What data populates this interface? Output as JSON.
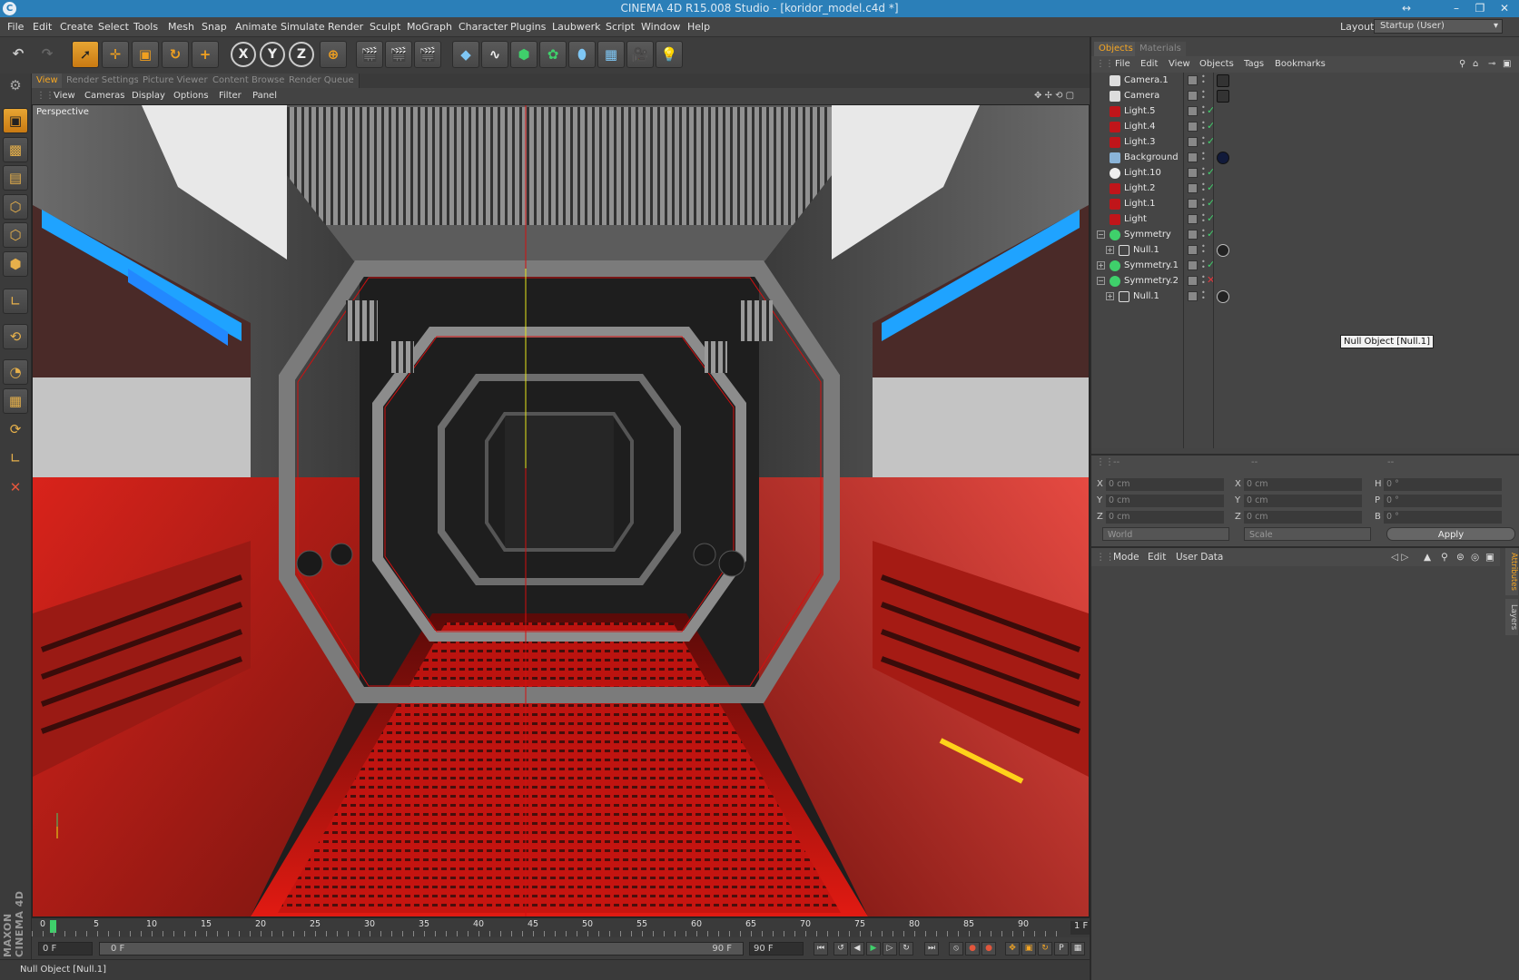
{
  "window": {
    "title": "CINEMA 4D R15.008 Studio - [koridor_model.c4d *]"
  },
  "menu": [
    "File",
    "Edit",
    "Create",
    "Select",
    "Tools",
    "Mesh",
    "Snap",
    "Animate",
    "Simulate",
    "Render",
    "Sculpt",
    "MoGraph",
    "Character",
    "Plugins",
    "Laubwerk",
    "Script",
    "Window",
    "Help"
  ],
  "layout": {
    "label": "Layout:",
    "value": "Startup (User)"
  },
  "axis_buttons": [
    "X",
    "Y",
    "Z"
  ],
  "view_tabs": [
    "View",
    "Render Settings",
    "Picture Viewer",
    "Content Browser",
    "Render Queue"
  ],
  "view_menu": [
    "View",
    "Cameras",
    "Display",
    "Options",
    "Filter",
    "Panel"
  ],
  "viewport": {
    "label": "Perspective"
  },
  "timeline": {
    "ticks": [
      "0",
      "5",
      "10",
      "15",
      "20",
      "25",
      "30",
      "35",
      "40",
      "45",
      "50",
      "55",
      "60",
      "65",
      "70",
      "75",
      "80",
      "85",
      "90"
    ],
    "current_frame": "1 F",
    "start": "0 F",
    "slider_start": "0 F",
    "slider_end": "90 F",
    "end": "90 F"
  },
  "status": "Null Object [Null.1]",
  "branding": "MAXON CINEMA 4D",
  "right_tabs": [
    "Objects",
    "Materials"
  ],
  "object_menu": [
    "File",
    "Edit",
    "View",
    "Objects",
    "Tags",
    "Bookmarks"
  ],
  "objects": [
    {
      "name": "Camera.1",
      "icon": "camera",
      "check": ""
    },
    {
      "name": "Camera",
      "icon": "camera",
      "check": ""
    },
    {
      "name": "Light.5",
      "icon": "light",
      "check": "✓"
    },
    {
      "name": "Light.4",
      "icon": "light",
      "check": "✓"
    },
    {
      "name": "Light.3",
      "icon": "light",
      "check": "✓"
    },
    {
      "name": "Background",
      "icon": "background",
      "check": ""
    },
    {
      "name": "Light.10",
      "icon": "light-white",
      "check": "✓"
    },
    {
      "name": "Light.2",
      "icon": "light",
      "check": "✓"
    },
    {
      "name": "Light.1",
      "icon": "light",
      "check": "✓"
    },
    {
      "name": "Light",
      "icon": "light",
      "check": "✓"
    },
    {
      "name": "Symmetry",
      "icon": "symmetry",
      "check": "✓"
    },
    {
      "name": "Null.1",
      "icon": "null",
      "check": ""
    },
    {
      "name": "Symmetry.1",
      "icon": "symmetry",
      "check": "✓"
    },
    {
      "name": "Symmetry.2",
      "icon": "symmetry",
      "check": "✕"
    },
    {
      "name": "Null.1",
      "icon": "null",
      "check": ""
    }
  ],
  "tooltip": "Null Object [Null.1]",
  "coords": {
    "headers": [
      "--",
      "--",
      "--"
    ],
    "rows": [
      {
        "a": "X",
        "av": "0 cm",
        "b": "X",
        "bv": "0 cm",
        "c": "H",
        "cv": "0 °"
      },
      {
        "a": "Y",
        "av": "0 cm",
        "b": "Y",
        "bv": "0 cm",
        "c": "P",
        "cv": "0 °"
      },
      {
        "a": "Z",
        "av": "0 cm",
        "b": "Z",
        "bv": "0 cm",
        "c": "B",
        "cv": "0 °"
      }
    ],
    "space": "World",
    "mode": "Scale",
    "apply": "Apply"
  },
  "attributes_menu": [
    "Mode",
    "Edit",
    "User Data"
  ],
  "side_tabs": [
    "Attributes",
    "Layers"
  ],
  "colors": {
    "accent": "#f5a623",
    "titlebar": "#2b7fb8",
    "red_light": "#d40f0f"
  }
}
